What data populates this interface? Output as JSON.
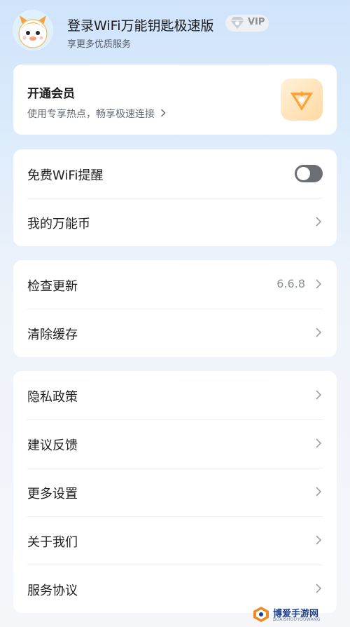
{
  "header": {
    "title": "登录WiFi万能钥匙极速版",
    "subtitle": "享更多优质服务",
    "vip_badge": "VIP"
  },
  "member_card": {
    "title": "开通会员",
    "subtitle": "使用专享热点，畅享极速连接"
  },
  "group1": [
    {
      "label": "免费WiFi提醒",
      "toggle_on": false
    },
    {
      "label": "我的万能币"
    }
  ],
  "group2": [
    {
      "label": "检查更新",
      "value": "6.6.8"
    },
    {
      "label": "清除缓存"
    }
  ],
  "group3": [
    {
      "label": "隐私政策"
    },
    {
      "label": "建议反馈"
    },
    {
      "label": "更多设置"
    },
    {
      "label": "关于我们"
    },
    {
      "label": "服务协议"
    }
  ],
  "watermark": {
    "text": "博爱手游网",
    "subtext": "BOAISHOUYOUWANG"
  },
  "colors": {
    "background_top": "#cfe3fb",
    "card": "#ffffff",
    "toggle_off": "#6b6e73",
    "member_logo": "#ffd9a3",
    "watermark": "#1b3d8a"
  }
}
